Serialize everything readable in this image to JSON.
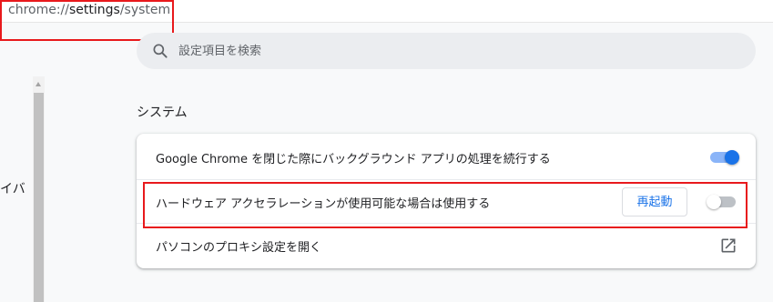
{
  "addressbar": {
    "scheme": "chrome://",
    "host": "settings",
    "path": "/system"
  },
  "search": {
    "placeholder": "設定項目を検索",
    "icon": "search-icon"
  },
  "sidebar": {
    "partial_label": "イバ"
  },
  "section": {
    "title": "システム"
  },
  "settings": {
    "background_apps": {
      "label": "Google Chrome を閉じた際にバックグラウンド アプリの処理を続行する",
      "enabled": true
    },
    "hardware_acceleration": {
      "label": "ハードウェア アクセラレーションが使用可能な場合は使用する",
      "enabled": false,
      "relaunch_label": "再起動"
    },
    "proxy": {
      "label": "パソコンのプロキシ設定を開く",
      "icon": "open-in-new-icon"
    }
  },
  "colors": {
    "accent": "#1a73e8",
    "highlight": "#e8191c"
  }
}
